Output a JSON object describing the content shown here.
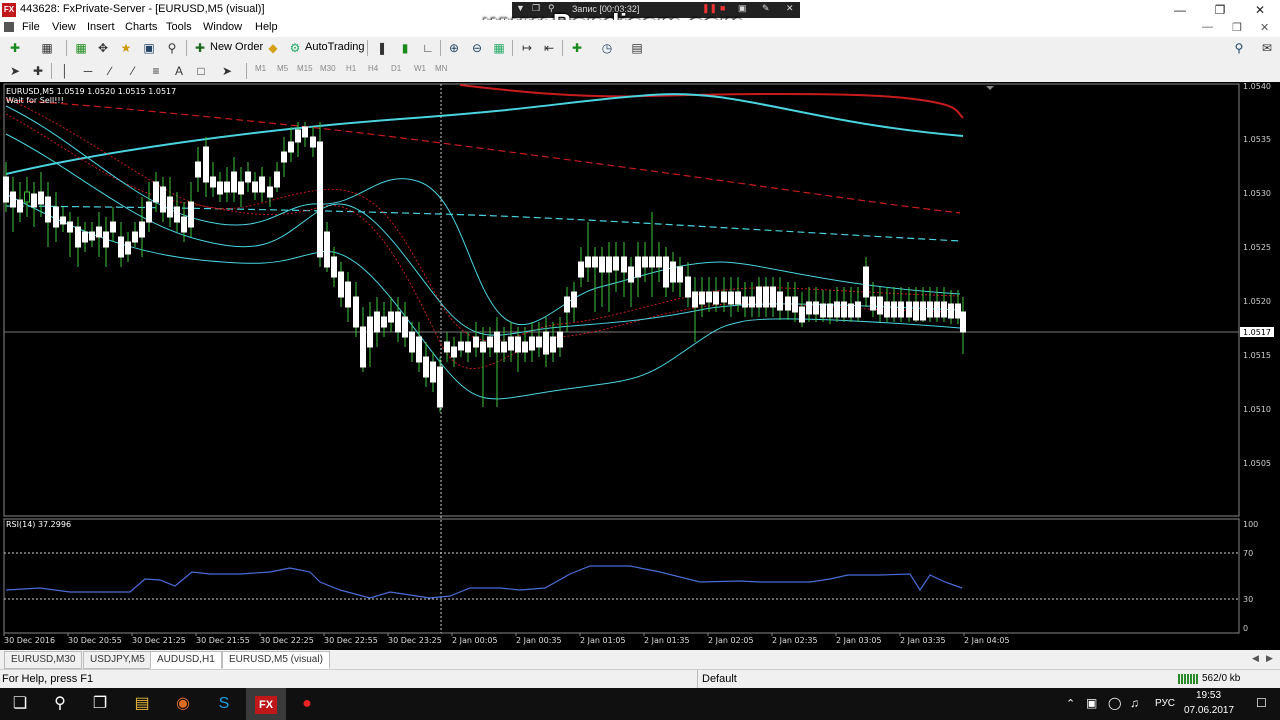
{
  "window": {
    "title": "443628: FxPrivate-Server - [EURUSD,M5 (visual)]",
    "app_icon_text": "FX"
  },
  "overlay": {
    "watermark": "www.Bandicam.com",
    "recording_label": "Запис [00:03:32]"
  },
  "menu": [
    "File",
    "View",
    "Insert",
    "Charts",
    "Tools",
    "Window",
    "Help"
  ],
  "toolbar": {
    "new_order": "New Order",
    "autotrading": "AutoTrading",
    "timeframes": [
      "M1",
      "M5",
      "M15",
      "M30",
      "H1",
      "H4",
      "D1",
      "W1",
      "MN"
    ]
  },
  "chart": {
    "header": "EURUSD,M5  1.0519 1.0520 1.0515 1.0517",
    "ea_comment": "Wait for Sell!!!",
    "price_labels": [
      "1.0540",
      "1.0535",
      "1.0530",
      "1.0525",
      "1.0520",
      "1.0517",
      "1.0515",
      "1.0510",
      "1.0505"
    ],
    "current_price": "1.0517",
    "rsi_header": "RSI(14) 37.2996",
    "rsi_levels": [
      "100",
      "70",
      "30",
      "0"
    ],
    "time_labels": [
      "30 Dec 2016",
      "30 Dec 20:55",
      "30 Dec 21:25",
      "30 Dec 21:55",
      "30 Dec 22:25",
      "30 Dec 22:55",
      "30 Dec 23:25",
      "2 Jan 00:05",
      "2 Jan 00:35",
      "2 Jan 01:05",
      "2 Jan 01:35",
      "2 Jan 02:05",
      "2 Jan 02:35",
      "2 Jan 03:05",
      "2 Jan 03:35",
      "2 Jan 04:05"
    ]
  },
  "tabs": [
    {
      "label": "EURUSD,M30",
      "active": false
    },
    {
      "label": "USDJPY,M5",
      "active": false
    },
    {
      "label": "AUDUSD,H1",
      "active": false
    },
    {
      "label": "EURUSD,M5 (visual)",
      "active": true
    }
  ],
  "status": {
    "help": "For Help, press F1",
    "profile": "Default",
    "traffic": "562/0 kb"
  },
  "taskbar": {
    "lang": "РУС",
    "time": "19:53",
    "date": "07.06.2017"
  }
}
